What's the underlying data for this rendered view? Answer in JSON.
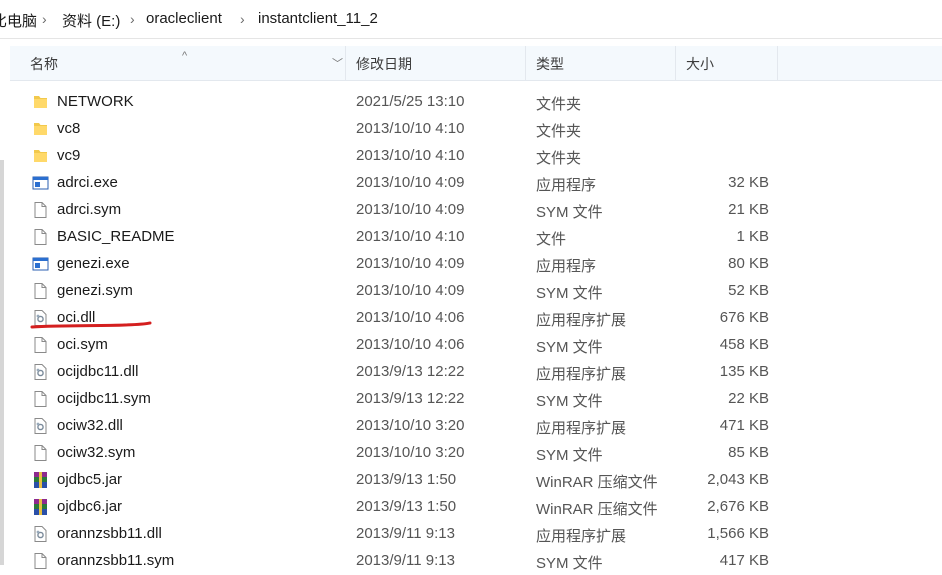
{
  "breadcrumb": [
    "此电脑",
    "资料 (E:)",
    "oracleclient",
    "instantclient_11_2"
  ],
  "breadcrumb_first_visible": "比电脑",
  "columns": {
    "name": "名称",
    "date": "修改日期",
    "type": "类型",
    "size": "大小"
  },
  "rows": [
    {
      "name": "NETWORK",
      "date": "2021/5/25 13:10",
      "type": "文件夹",
      "size": "",
      "icon": "folder-icon"
    },
    {
      "name": "vc8",
      "date": "2013/10/10 4:10",
      "type": "文件夹",
      "size": "",
      "icon": "folder-icon"
    },
    {
      "name": "vc9",
      "date": "2013/10/10 4:10",
      "type": "文件夹",
      "size": "",
      "icon": "folder-icon"
    },
    {
      "name": "adrci.exe",
      "date": "2013/10/10 4:09",
      "type": "应用程序",
      "size": "32 KB",
      "icon": "exe-icon"
    },
    {
      "name": "adrci.sym",
      "date": "2013/10/10 4:09",
      "type": "SYM 文件",
      "size": "21 KB",
      "icon": "file-icon"
    },
    {
      "name": "BASIC_README",
      "date": "2013/10/10 4:10",
      "type": "文件",
      "size": "1 KB",
      "icon": "file-icon"
    },
    {
      "name": "genezi.exe",
      "date": "2013/10/10 4:09",
      "type": "应用程序",
      "size": "80 KB",
      "icon": "exe-icon"
    },
    {
      "name": "genezi.sym",
      "date": "2013/10/10 4:09",
      "type": "SYM 文件",
      "size": "52 KB",
      "icon": "file-icon"
    },
    {
      "name": "oci.dll",
      "date": "2013/10/10 4:06",
      "type": "应用程序扩展",
      "size": "676 KB",
      "icon": "dll-icon"
    },
    {
      "name": "oci.sym",
      "date": "2013/10/10 4:06",
      "type": "SYM 文件",
      "size": "458 KB",
      "icon": "file-icon"
    },
    {
      "name": "ocijdbc11.dll",
      "date": "2013/9/13 12:22",
      "type": "应用程序扩展",
      "size": "135 KB",
      "icon": "dll-icon"
    },
    {
      "name": "ocijdbc11.sym",
      "date": "2013/9/13 12:22",
      "type": "SYM 文件",
      "size": "22 KB",
      "icon": "file-icon"
    },
    {
      "name": "ociw32.dll",
      "date": "2013/10/10 3:20",
      "type": "应用程序扩展",
      "size": "471 KB",
      "icon": "dll-icon"
    },
    {
      "name": "ociw32.sym",
      "date": "2013/10/10 3:20",
      "type": "SYM 文件",
      "size": "85 KB",
      "icon": "file-icon"
    },
    {
      "name": "ojdbc5.jar",
      "date": "2013/9/13 1:50",
      "type": "WinRAR 压缩文件",
      "size": "2,043 KB",
      "icon": "winrar-icon"
    },
    {
      "name": "ojdbc6.jar",
      "date": "2013/9/13 1:50",
      "type": "WinRAR 压缩文件",
      "size": "2,676 KB",
      "icon": "winrar-icon"
    },
    {
      "name": "orannzsbb11.dll",
      "date": "2013/9/11 9:13",
      "type": "应用程序扩展",
      "size": "1,566 KB",
      "icon": "dll-icon"
    },
    {
      "name": "orannzsbb11.sym",
      "date": "2013/9/11 9:13",
      "type": "SYM 文件",
      "size": "417 KB",
      "icon": "file-icon"
    }
  ],
  "annotation": {
    "color": "#d41f1f"
  }
}
